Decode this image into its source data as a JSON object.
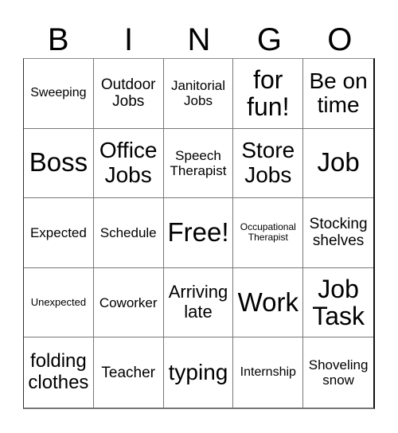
{
  "header": [
    "B",
    "I",
    "N",
    "G",
    "O"
  ],
  "cells": [
    "Sweeping",
    "Outdoor Jobs",
    "Janitorial Jobs",
    "for fun!",
    "Be on time",
    "Boss",
    "Office Jobs",
    "Speech Therapist",
    "Store Jobs",
    "Job",
    "Expected",
    "Schedule",
    "Free!",
    "Occupational Therapist",
    "Stocking shelves",
    "Unexpected",
    "Coworker",
    "Arriving late",
    "Work",
    "Job Task",
    "folding clothes",
    "Teacher",
    "typing",
    "Internship",
    "Shoveling snow"
  ]
}
